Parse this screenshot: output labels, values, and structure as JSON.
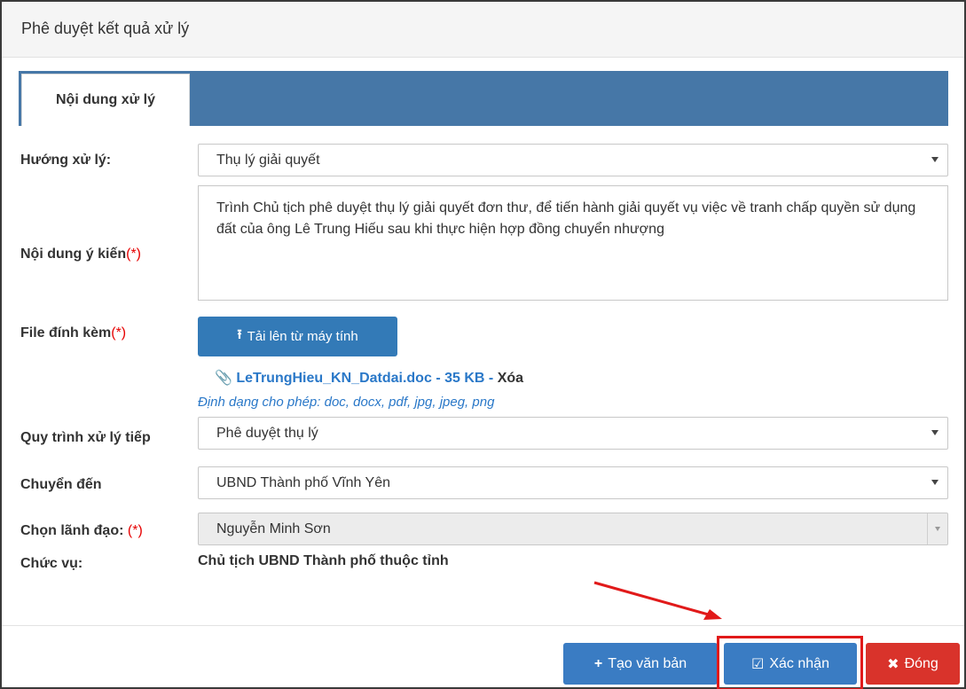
{
  "modal": {
    "title": "Phê duyệt kết quả xử lý"
  },
  "tabs": [
    {
      "label": "Nội dung xử lý",
      "active": true
    }
  ],
  "form": {
    "handling_label": "Hướng xử lý:",
    "handling_value": "Thụ lý giải quyết",
    "opinion_label": "Nội dung ý kiến",
    "opinion_value": "Trình Chủ tịch phê duyệt thụ lý giải quyết đơn thư, để tiến hành giải quyết vụ việc về tranh chấp quyền sử dụng đất của ông Lê Trung Hiếu sau khi thực hiện hợp đồng chuyển nhượng",
    "attachment_label": "File đính kèm",
    "upload_label": "Tải lên từ máy tính",
    "file_name": "LeTrungHieu_KN_Datdai.doc",
    "file_size": "35 KB",
    "file_delete_label": "Xóa",
    "allowed_formats": "Định dạng cho phép: doc, docx, pdf, jpg, jpeg, png",
    "next_process_label": "Quy trình xử lý tiếp",
    "next_process_value": "Phê duyệt thụ lý",
    "transfer_label": "Chuyển đến",
    "transfer_value": "UBND Thành phố Vĩnh Yên",
    "leader_label": "Chọn lãnh đạo:",
    "leader_value": "Nguyễn Minh Sơn",
    "position_label": "Chức vụ:",
    "position_value": "Chủ tịch UBND Thành phố thuộc tỉnh",
    "required_mark": "(*)",
    "separator": "-"
  },
  "footer": {
    "create_doc_label": "Tạo văn bản",
    "confirm_label": "Xác nhận",
    "close_label": "Đóng"
  },
  "icons": {
    "upload": "upload-icon",
    "paperclip": "paperclip-icon",
    "plus": "plus-icon",
    "check": "check-square-icon",
    "close": "close-icon"
  },
  "colors": {
    "primary": "#337ab7",
    "tab_bar": "#4677a7",
    "danger": "#d9332b",
    "link": "#2a78c8",
    "required": "#e60000",
    "highlight": "#e11a1a"
  }
}
